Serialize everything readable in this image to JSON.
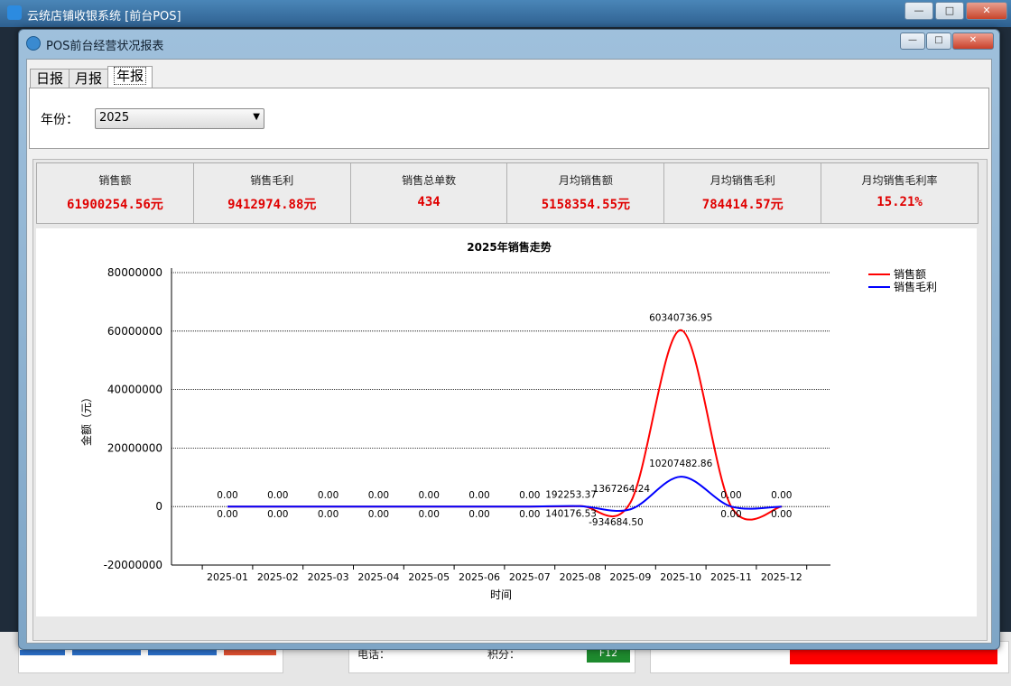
{
  "background_app": {
    "title": "云统店铺收银系统 [前台POS]",
    "phone_label": "电话：",
    "points_label": "积分：",
    "f12_label": "F12"
  },
  "dialog": {
    "title": "POS前台经营状况报表",
    "tabs": [
      "日报",
      "月报",
      "年报"
    ],
    "active_tab": "年报",
    "year_label": "年份：",
    "year_value": "2025"
  },
  "stats": [
    {
      "label": "销售额",
      "value": "61900254.56元"
    },
    {
      "label": "销售毛利",
      "value": "9412974.88元"
    },
    {
      "label": "销售总单数",
      "value": "434"
    },
    {
      "label": "月均销售额",
      "value": "5158354.55元"
    },
    {
      "label": "月均销售毛利",
      "value": "784414.57元"
    },
    {
      "label": "月均销售毛利率",
      "value": "15.21%"
    }
  ],
  "chart_data": {
    "type": "line",
    "title": "2025年销售走势",
    "xlabel": "时间",
    "ylabel": "金额（元）",
    "ylim": [
      -20000000,
      80000000
    ],
    "yticks": [
      -20000000,
      0,
      20000000,
      40000000,
      60000000,
      80000000
    ],
    "categories": [
      "2025-01",
      "2025-02",
      "2025-03",
      "2025-04",
      "2025-05",
      "2025-06",
      "2025-07",
      "2025-08",
      "2025-09",
      "2025-10",
      "2025-11",
      "2025-12"
    ],
    "series": [
      {
        "name": "销售额",
        "color": "#ff0000",
        "values": [
          0,
          0,
          0,
          0,
          0,
          0,
          0,
          192253.37,
          1367264.24,
          60340736.95,
          0,
          0
        ],
        "labels": [
          "0.00",
          "0.00",
          "0.00",
          "0.00",
          "0.00",
          "0.00",
          "0.00",
          "192253.37",
          "1367264.24",
          "60340736.95",
          "0.00",
          "0.00"
        ]
      },
      {
        "name": "销售毛利",
        "color": "#0000ff",
        "values": [
          0,
          0,
          0,
          0,
          0,
          0,
          0,
          140176.53,
          -934684.5,
          10207482.86,
          0,
          0
        ],
        "labels": [
          "0.00",
          "0.00",
          "0.00",
          "0.00",
          "0.00",
          "0.00",
          "0.00",
          "140176.53",
          "-934684.50",
          "10207482.86",
          "0.00",
          "0.00"
        ]
      }
    ],
    "grid": true,
    "legend": "top-right"
  }
}
